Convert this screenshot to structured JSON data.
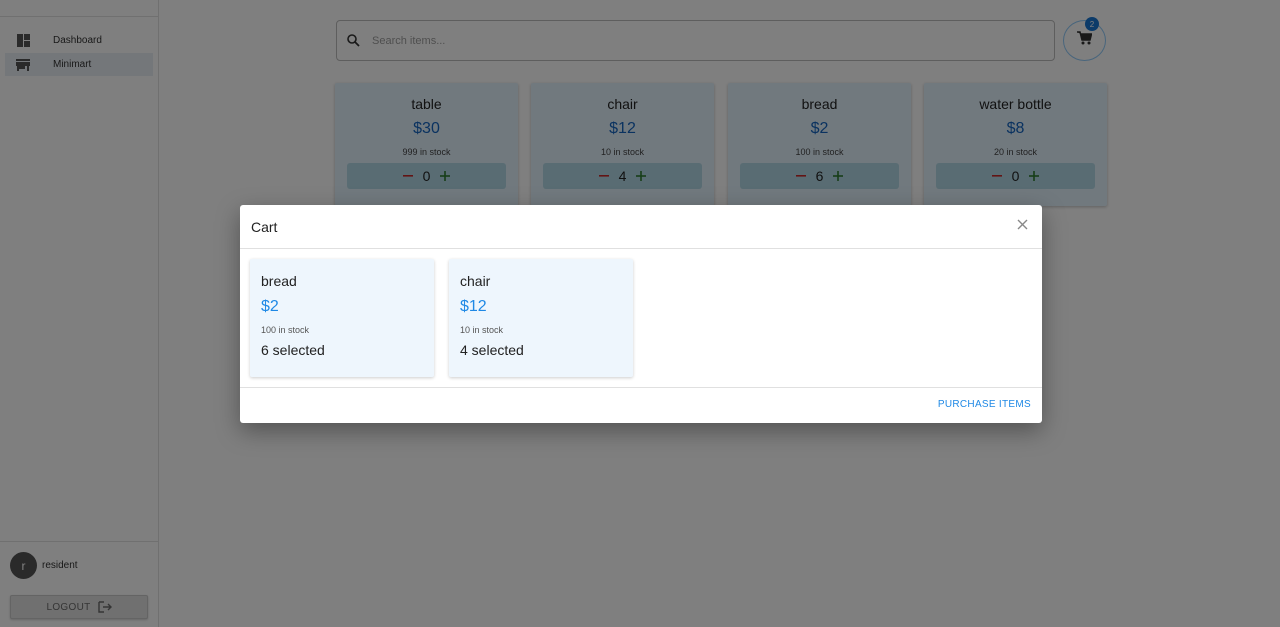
{
  "sidebar": {
    "items": [
      {
        "label": "Dashboard",
        "icon": "dashboard-icon"
      },
      {
        "label": "Minimart",
        "icon": "store-icon",
        "active": true
      }
    ],
    "user": {
      "avatar_letter": "r",
      "name": "resident"
    },
    "logout_label": "LOGOUT"
  },
  "search": {
    "placeholder": "Search items...",
    "value": ""
  },
  "cart": {
    "badge_count": "2"
  },
  "products": [
    {
      "name": "table",
      "price": "$30",
      "stock": "999 in stock",
      "qty": "0"
    },
    {
      "name": "chair",
      "price": "$12",
      "stock": "10 in stock",
      "qty": "4"
    },
    {
      "name": "bread",
      "price": "$2",
      "stock": "100 in stock",
      "qty": "6"
    },
    {
      "name": "water bottle",
      "price": "$8",
      "stock": "20 in stock",
      "qty": "0"
    }
  ],
  "modal": {
    "title": "Cart",
    "items": [
      {
        "name": "bread",
        "price": "$2",
        "stock": "100 in stock",
        "selected": "6 selected"
      },
      {
        "name": "chair",
        "price": "$12",
        "stock": "10 in stock",
        "selected": "4 selected"
      }
    ],
    "purchase_label": "PURCHASE ITEMS"
  },
  "colors": {
    "accent": "#1e88e5",
    "price": "#1565c0",
    "card_bg": "#e3f2fd",
    "badge": "#1976d2"
  }
}
